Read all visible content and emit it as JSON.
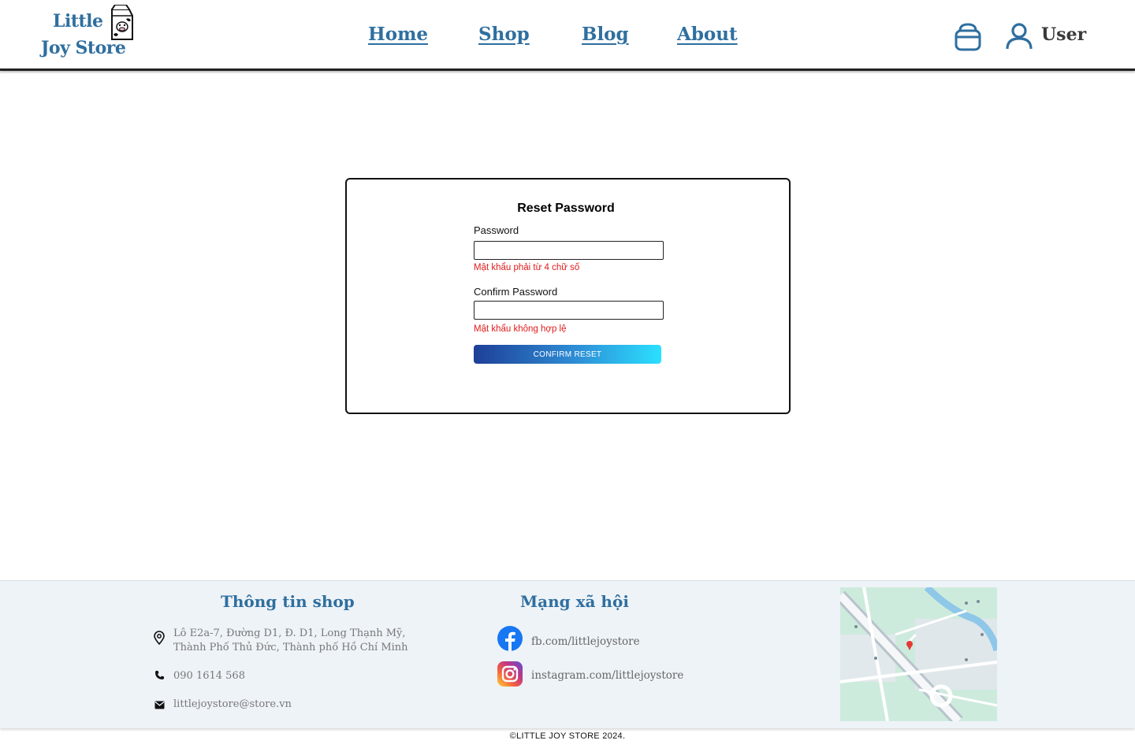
{
  "header": {
    "logo_line1": "Little",
    "logo_line2": "Joy Store",
    "nav": [
      {
        "label": "Home"
      },
      {
        "label": "Shop"
      },
      {
        "label": "Blog"
      },
      {
        "label": "About"
      }
    ],
    "user_label": "User"
  },
  "form": {
    "title": "Reset Password",
    "password_label": "Password",
    "password_value": "",
    "password_error": "Mật khẩu phải từ 4 chữ số",
    "confirm_label": "Confirm Password",
    "confirm_value": "",
    "confirm_error": "Mật khẩu không hợp lệ",
    "submit_label": "CONFIRM RESET"
  },
  "footer": {
    "shop_info_heading": "Thông tin shop",
    "address_line1": "Lô E2a-7, Đường D1, Đ. D1, Long Thạnh Mỹ,",
    "address_line2": "Thành Phố Thủ Đức, Thành phố Hồ Chí Minh",
    "phone": "090 1614 568",
    "email": "littlejoystore@store.vn",
    "social_heading": "Mạng xã hội",
    "facebook": "fb.com/littlejoystore",
    "instagram": "instagram.com/littlejoystore",
    "copyright": "©LITTLE JOY STORE 2024."
  },
  "colors": {
    "brand_blue": "#2f6f9f",
    "error_red": "#e01b1b",
    "footer_bg": "#eef3f8"
  }
}
